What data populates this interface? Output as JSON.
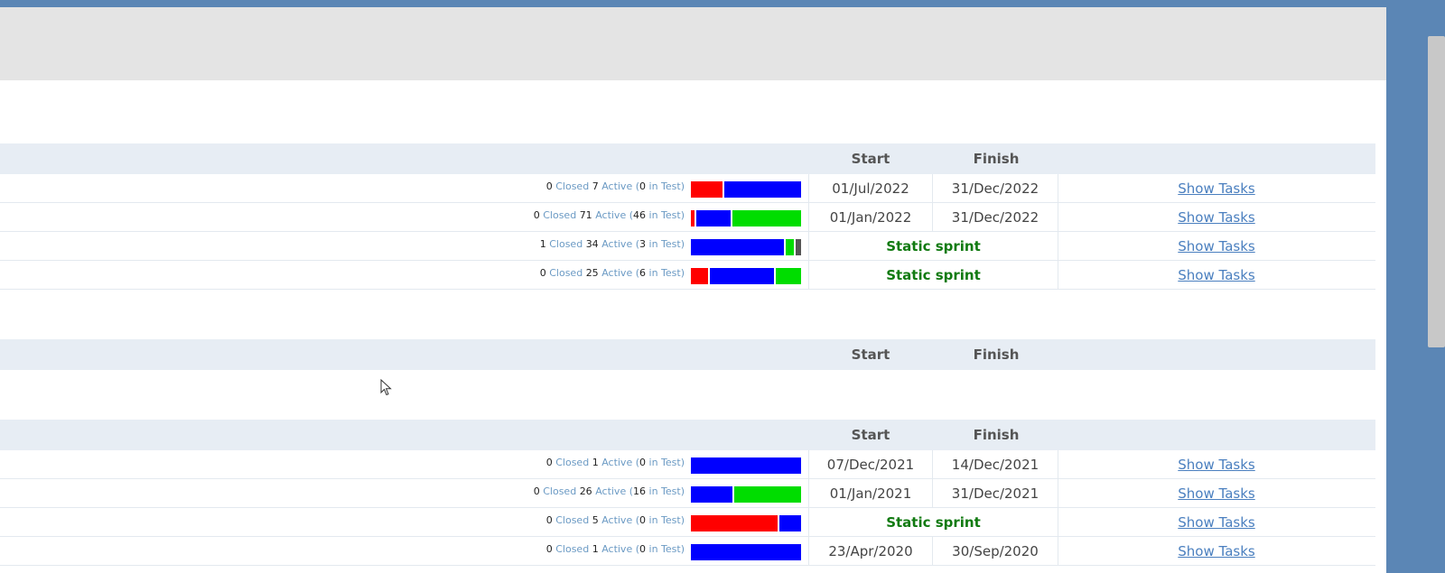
{
  "sections": [
    {
      "header": {
        "start": "Start",
        "finish": "Finish"
      },
      "rows": [
        {
          "closed": "0",
          "closed_label": "Closed",
          "active": "7",
          "active_label": "Active",
          "in_test": "0",
          "in_test_label": "in Test",
          "bar": [
            {
              "color": "red",
              "frac": 0.29
            },
            {
              "color": "blue",
              "frac": 0.71
            }
          ],
          "start": "01/Jul/2022",
          "finish": "31/Dec/2022",
          "link": "Show Tasks"
        },
        {
          "closed": "0",
          "closed_label": "Closed",
          "active": "71",
          "active_label": "Active",
          "in_test": "46",
          "in_test_label": "in Test",
          "bar": [
            {
              "color": "red",
              "frac": 0.03
            },
            {
              "color": "blue",
              "frac": 0.33
            },
            {
              "color": "green",
              "frac": 0.64
            }
          ],
          "start": "01/Jan/2022",
          "finish": "31/Dec/2022",
          "link": "Show Tasks"
        },
        {
          "closed": "1",
          "closed_label": "Closed",
          "active": "34",
          "active_label": "Active",
          "in_test": "3",
          "in_test_label": "in Test",
          "bar": [
            {
              "color": "blue",
              "frac": 0.87
            },
            {
              "color": "green",
              "frac": 0.08
            },
            {
              "color": "gray",
              "frac": 0.05
            }
          ],
          "static": "Static sprint",
          "link": "Show Tasks"
        },
        {
          "closed": "0",
          "closed_label": "Closed",
          "active": "25",
          "active_label": "Active",
          "in_test": "6",
          "in_test_label": "in Test",
          "bar": [
            {
              "color": "red",
              "frac": 0.16
            },
            {
              "color": "blue",
              "frac": 0.6
            },
            {
              "color": "green",
              "frac": 0.24
            }
          ],
          "static": "Static sprint",
          "link": "Show Tasks"
        }
      ]
    },
    {
      "header": {
        "start": "Start",
        "finish": "Finish"
      },
      "rows": []
    },
    {
      "header": {
        "start": "Start",
        "finish": "Finish"
      },
      "rows": [
        {
          "closed": "0",
          "closed_label": "Closed",
          "active": "1",
          "active_label": "Active",
          "in_test": "0",
          "in_test_label": "in Test",
          "bar": [
            {
              "color": "blue",
              "frac": 1.0
            }
          ],
          "start": "07/Dec/2021",
          "finish": "14/Dec/2021",
          "link": "Show Tasks"
        },
        {
          "closed": "0",
          "closed_label": "Closed",
          "active": "26",
          "active_label": "Active",
          "in_test": "16",
          "in_test_label": "in Test",
          "bar": [
            {
              "color": "blue",
              "frac": 0.38
            },
            {
              "color": "green",
              "frac": 0.62
            }
          ],
          "start": "01/Jan/2021",
          "finish": "31/Dec/2021",
          "link": "Show Tasks"
        },
        {
          "closed": "0",
          "closed_label": "Closed",
          "active": "5",
          "active_label": "Active",
          "in_test": "0",
          "in_test_label": "in Test",
          "bar": [
            {
              "color": "red",
              "frac": 0.8
            },
            {
              "color": "blue",
              "frac": 0.2
            }
          ],
          "static": "Static sprint",
          "link": "Show Tasks"
        },
        {
          "closed": "0",
          "closed_label": "Closed",
          "active": "1",
          "active_label": "Active",
          "in_test": "0",
          "in_test_label": "in Test",
          "bar": [
            {
              "color": "blue",
              "frac": 1.0
            }
          ],
          "start": "23/Apr/2020",
          "finish": "30/Sep/2020",
          "link": "Show Tasks"
        }
      ]
    }
  ]
}
